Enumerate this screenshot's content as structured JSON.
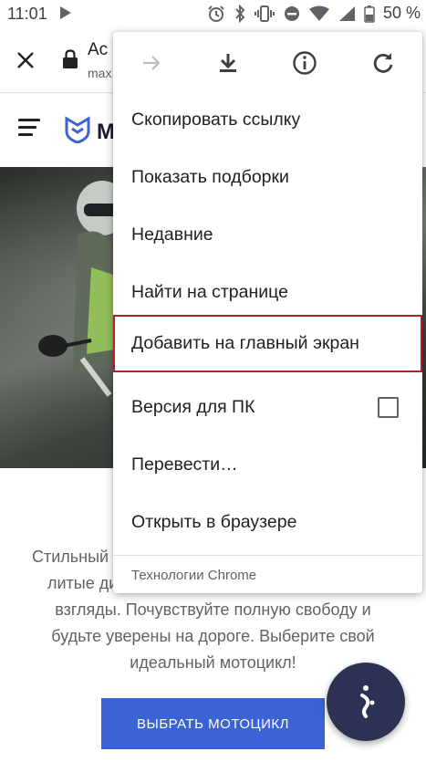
{
  "status_bar": {
    "time": "11:01",
    "battery": "50 %"
  },
  "toolbar": {
    "title": "Ac",
    "url": "max"
  },
  "site": {
    "logo_text": "M"
  },
  "intro_text": {
    "line1": "Стильный",
    "line2": "литые дис",
    "line3": "взгляды. Почувствуйте полную свободу и",
    "line4": "будьте уверены на дороге. Выберите свой",
    "line5": "идеальный мотоцикл!"
  },
  "cta": {
    "label": "ВЫБРАТЬ МОТОЦИКЛ"
  },
  "menu": {
    "items": [
      {
        "label": "Скопировать ссылку"
      },
      {
        "label": "Показать подборки"
      },
      {
        "label": "Недавние"
      },
      {
        "label": "Найти на странице"
      },
      {
        "label": "Добавить на главный экран"
      },
      {
        "label": "Версия для ПК",
        "checkbox": false
      },
      {
        "label": "Перевести…"
      },
      {
        "label": "Открыть в браузере"
      }
    ],
    "footer": "Технологии Chrome"
  },
  "icons": {
    "forward": "forward-arrow-icon",
    "download": "download-icon",
    "info": "info-icon",
    "refresh": "refresh-icon"
  },
  "colors": {
    "accent": "#3b63d6",
    "highlight": "#b22222",
    "fab": "#2d3153"
  }
}
